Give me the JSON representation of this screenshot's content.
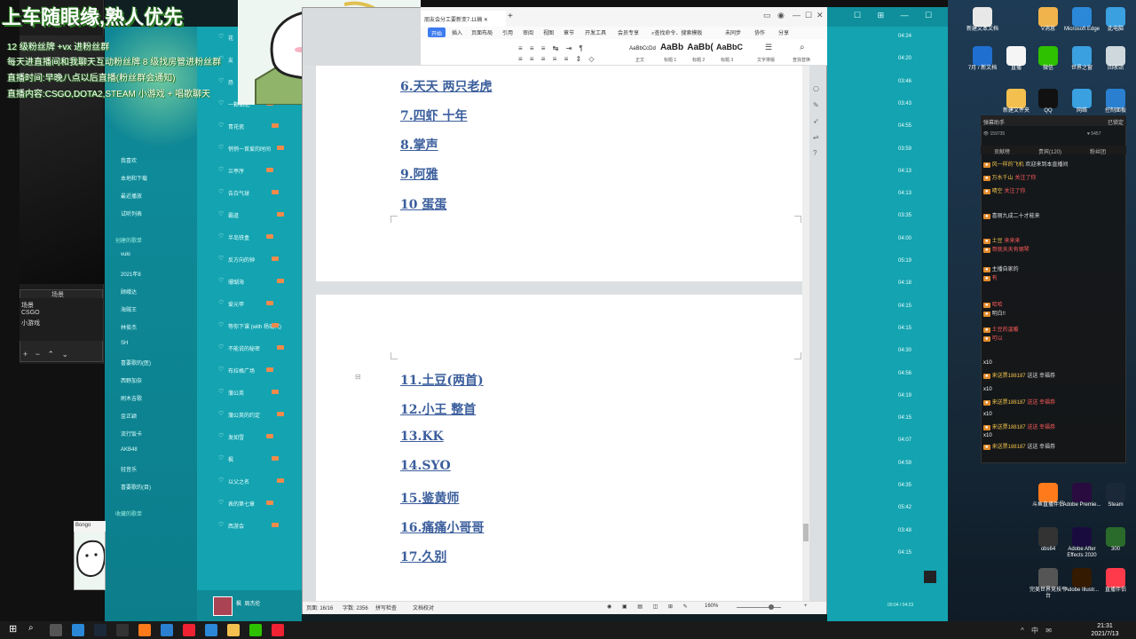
{
  "overlay": {
    "title": "上车随眼缘,熟人优先",
    "lines": [
      "12 级粉丝牌 +vx 进粉丝群",
      "每天进直播间和我聊天互动粉丝牌 8 级找房管进粉丝群",
      "直播时间:早晚八点以后直播(粉丝群会通知)",
      "直播内容:CSGO,DOTA2,STEAM 小游戏 + 唱歌聊天"
    ]
  },
  "obs": {
    "scene_title": "场景",
    "scenes": [
      "场景",
      "CSGO",
      "小游戏"
    ],
    "scene_controls": "+ − ⌃ ⌄",
    "mini_window_title": "Bongo"
  },
  "music": {
    "nav_items": [
      "我喜欢",
      "本地和下载",
      "最近播放",
      "试听列表",
      "创建的歌单",
      "vuki",
      "2021年8",
      "顾峨达",
      "海贼王",
      "林俊杰",
      "SH",
      "喜要歌的(医)",
      "西野加奈",
      "刷木吉歌",
      "金正颖",
      "流行饭卡",
      "AKB48",
      "轻音乐",
      "喜要歌的(目)",
      "收藏的歌单"
    ],
    "songs": [
      "花",
      "友",
      "恐",
      "一颗仙北",
      "青花瓷",
      "悄悄一首爱的时间",
      "兰亭序",
      "告白气球",
      "霸道",
      "半岛铁盒",
      "反方向的钟",
      "珊瑚海",
      "爱元甲",
      "等你下课 (with 杨瑞代)",
      "不能说的秘密",
      "布拉格广场",
      "蒲公英",
      "蒲公英的约定",
      "发如雪",
      "枫",
      "以父之名",
      "表的第七章",
      "西游会"
    ],
    "durations": [
      "04:24",
      "04:20",
      "03:46",
      "03:43",
      "04:55",
      "03:59",
      "04:13",
      "04:13",
      "03:35",
      "04:00",
      "05:19",
      "04:18",
      "04:15",
      "04:15",
      "04:30",
      "04:56",
      "04:19",
      "04:15",
      "04:07",
      "04:59",
      "04:35",
      "05:42",
      "03:48",
      "04:15"
    ],
    "player_title": "枫",
    "player_artist": "周杰伦",
    "footer": "00:04 / 04:23"
  },
  "wps": {
    "tab_title": "朋友会分工要新变7.11稿",
    "menu": [
      "开始",
      "插入",
      "页面布局",
      "引用",
      "审阅",
      "视图",
      "章节",
      "开发工具",
      "会员专享",
      "查找命令、搜索模板",
      "未同步",
      "协作",
      "分享"
    ],
    "styles": [
      {
        "preview": "AaBbCcDd",
        "caption": "正文"
      },
      {
        "preview": "AaBb",
        "caption": "标题 1"
      },
      {
        "preview": "AaBb(",
        "caption": "标题 2"
      },
      {
        "preview": "AaBbC",
        "caption": "标题 3"
      }
    ],
    "style_extra": [
      "文字排版",
      "查找替换"
    ],
    "page1_lines": [
      "6.天天 两只老虎",
      "7.四虾 十年",
      "8.掌声",
      "9.阿雅",
      "10 蛋蛋"
    ],
    "page2_lines": [
      "11.土豆(两首)",
      "12.小王 整首",
      "13.KK",
      "14.SYO",
      "15.鉴黄师",
      "16.痛痛小哥哥",
      "17.久别"
    ],
    "status": {
      "page": "页面: 16/16",
      "words": "字数: 2356",
      "spell": "拼写检查",
      "proof": "文档校对",
      "zoom": "160%"
    }
  },
  "chat": {
    "header": "弹幕助手",
    "header_right": "已锁定",
    "viewers": "159735",
    "fans": "5457",
    "tabs": [
      "贡献榜",
      "贵宾(120)",
      "粉丝团"
    ],
    "messages": [
      {
        "user": "风一样的飞机",
        "text": "欢迎来到本直播间"
      },
      {
        "user": "万水千山",
        "text": "关注了你"
      },
      {
        "user": "晴空",
        "text": "关注了你"
      },
      {
        "user": "",
        "text": "喜丽九成二十才能来"
      },
      {
        "user": "土豆",
        "text": "来来来"
      },
      {
        "user": "",
        "text": "哥就天天有钢琴"
      },
      {
        "user": "",
        "text": "主播自家的"
      },
      {
        "user": "",
        "text": "有"
      },
      {
        "user": "",
        "text": "哈哈"
      },
      {
        "user": "",
        "text": "明白!!"
      },
      {
        "user": "",
        "text": "土豆的温暖"
      },
      {
        "user": "",
        "text": "可以"
      },
      {
        "user": "来送票188187",
        "text": "送送 幸福券"
      },
      {
        "user": "来送票188187",
        "text": "送送 幸福券"
      },
      {
        "user": "来送票188187",
        "text": "送送 幸福券"
      },
      {
        "user": "来送票188187",
        "text": "送送 幸福券"
      }
    ],
    "multiplier": "x10"
  },
  "desktop": {
    "icons": [
      {
        "label": "新建文本文档",
        "color": "#e8e8e8"
      },
      {
        "label": "V消息",
        "color": "#f0b44c"
      },
      {
        "label": "Microsoft Edge",
        "color": "#2b88d8"
      },
      {
        "label": "此电脑",
        "color": "#3aa0e0"
      },
      {
        "label": "7月 / 新文档",
        "color": "#1f6fd0"
      },
      {
        "label": "直播",
        "color": "#f5f5f5"
      },
      {
        "label": "微信",
        "color": "#2dc100"
      },
      {
        "label": "世界之窗",
        "color": "#3aa0e0"
      },
      {
        "label": "回收站",
        "color": "#cfd8dc"
      },
      {
        "label": "新建文件夹",
        "color": "#f3c04f"
      },
      {
        "label": "QQ",
        "color": "#111"
      },
      {
        "label": "网络",
        "color": "#3aa0e0"
      },
      {
        "label": "控制面板",
        "color": "#2a7fd0"
      },
      {
        "label": "Adobe Photosh...",
        "color": "#0b2d4f"
      },
      {
        "label": "斗鱼直播伴侣",
        "color": "#ff7a1a"
      },
      {
        "label": "Adobe Premie...",
        "color": "#2a0b3f"
      },
      {
        "label": "Steam",
        "color": "#1b2838"
      },
      {
        "label": "obs64",
        "color": "#333"
      },
      {
        "label": "Adobe After Effects 2020",
        "color": "#1a0b3f"
      },
      {
        "label": "300",
        "color": "#2a6a2a"
      },
      {
        "label": "完美世界竞技平台",
        "color": "#555"
      },
      {
        "label": "Adobe Illustr...",
        "color": "#331a00"
      },
      {
        "label": "直播伴侣",
        "color": "#ff3a4a"
      }
    ]
  },
  "taskbar": {
    "time": "21:31",
    "date": "2021/7/13",
    "tray": "^ 中 ✉"
  }
}
